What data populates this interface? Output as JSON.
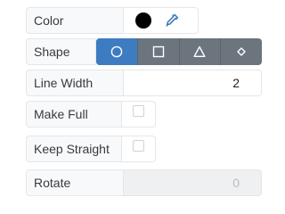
{
  "color": {
    "label": "Color",
    "value": "#000000",
    "picker_icon": "eyedropper-icon"
  },
  "shape": {
    "label": "Shape",
    "options": [
      {
        "name": "circle",
        "icon": "circle-icon",
        "selected": true
      },
      {
        "name": "square",
        "icon": "square-icon",
        "selected": false
      },
      {
        "name": "triangle",
        "icon": "triangle-icon",
        "selected": false
      },
      {
        "name": "diamond",
        "icon": "diamond-icon",
        "selected": false
      }
    ],
    "active_color": "#3d7cc0",
    "inactive_color": "#6c757d"
  },
  "line_width": {
    "label": "Line Width",
    "value": "2"
  },
  "make_full": {
    "label": "Make Full",
    "checked": false
  },
  "keep_straight": {
    "label": "Keep Straight",
    "checked": false
  },
  "rotate": {
    "label": "Rotate",
    "value": "0",
    "disabled": true
  }
}
